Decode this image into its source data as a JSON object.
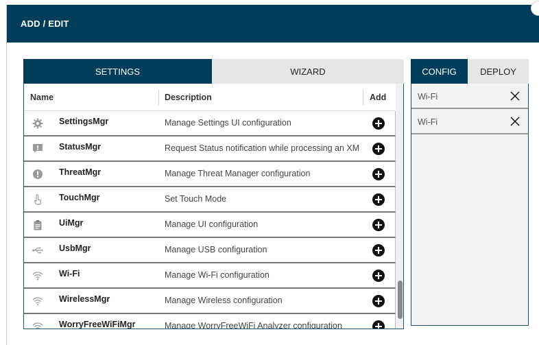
{
  "window": {
    "title": "ADD / EDIT"
  },
  "left_tabs": {
    "settings": "SETTINGS",
    "wizard": "WIZARD"
  },
  "table": {
    "columns": {
      "name": "Name",
      "description": "Description",
      "add": "Add"
    },
    "rows": [
      {
        "name": "SettingsMgr",
        "description": "Manage Settings UI configuration",
        "icon": "gear-icon"
      },
      {
        "name": "StatusMgr",
        "description": "Request Status notification while processing an XM",
        "icon": "alert-message-icon"
      },
      {
        "name": "ThreatMgr",
        "description": "Manage Threat Manager configuration",
        "icon": "exclamation-circle-icon"
      },
      {
        "name": "TouchMgr",
        "description": "Set Touch Mode",
        "icon": "touch-hand-icon"
      },
      {
        "name": "UiMgr",
        "description": "Manage UI configuration",
        "icon": "clipboard-icon"
      },
      {
        "name": "UsbMgr",
        "description": "Manage USB configuration",
        "icon": "usb-icon"
      },
      {
        "name": "Wi-Fi",
        "description": "Manage Wi-Fi configuration",
        "icon": "wifi-icon"
      },
      {
        "name": "WirelessMgr",
        "description": "Manage Wireless configuration",
        "icon": "wifi-icon"
      },
      {
        "name": "WorryFreeWiFiMgr",
        "description": "Manage WorryFreeWiFi Analyzer configuration",
        "icon": "wifi-icon"
      }
    ]
  },
  "right_tabs": {
    "config": "CONFIG",
    "deploy": "DEPLOY"
  },
  "config_items": [
    {
      "label": "Wi-Fi"
    },
    {
      "label": "Wi-Fi"
    }
  ],
  "colors": {
    "header_bg": "#003d5b",
    "active_tab": "#003d5b",
    "inactive_tab": "#e6e6e6"
  }
}
